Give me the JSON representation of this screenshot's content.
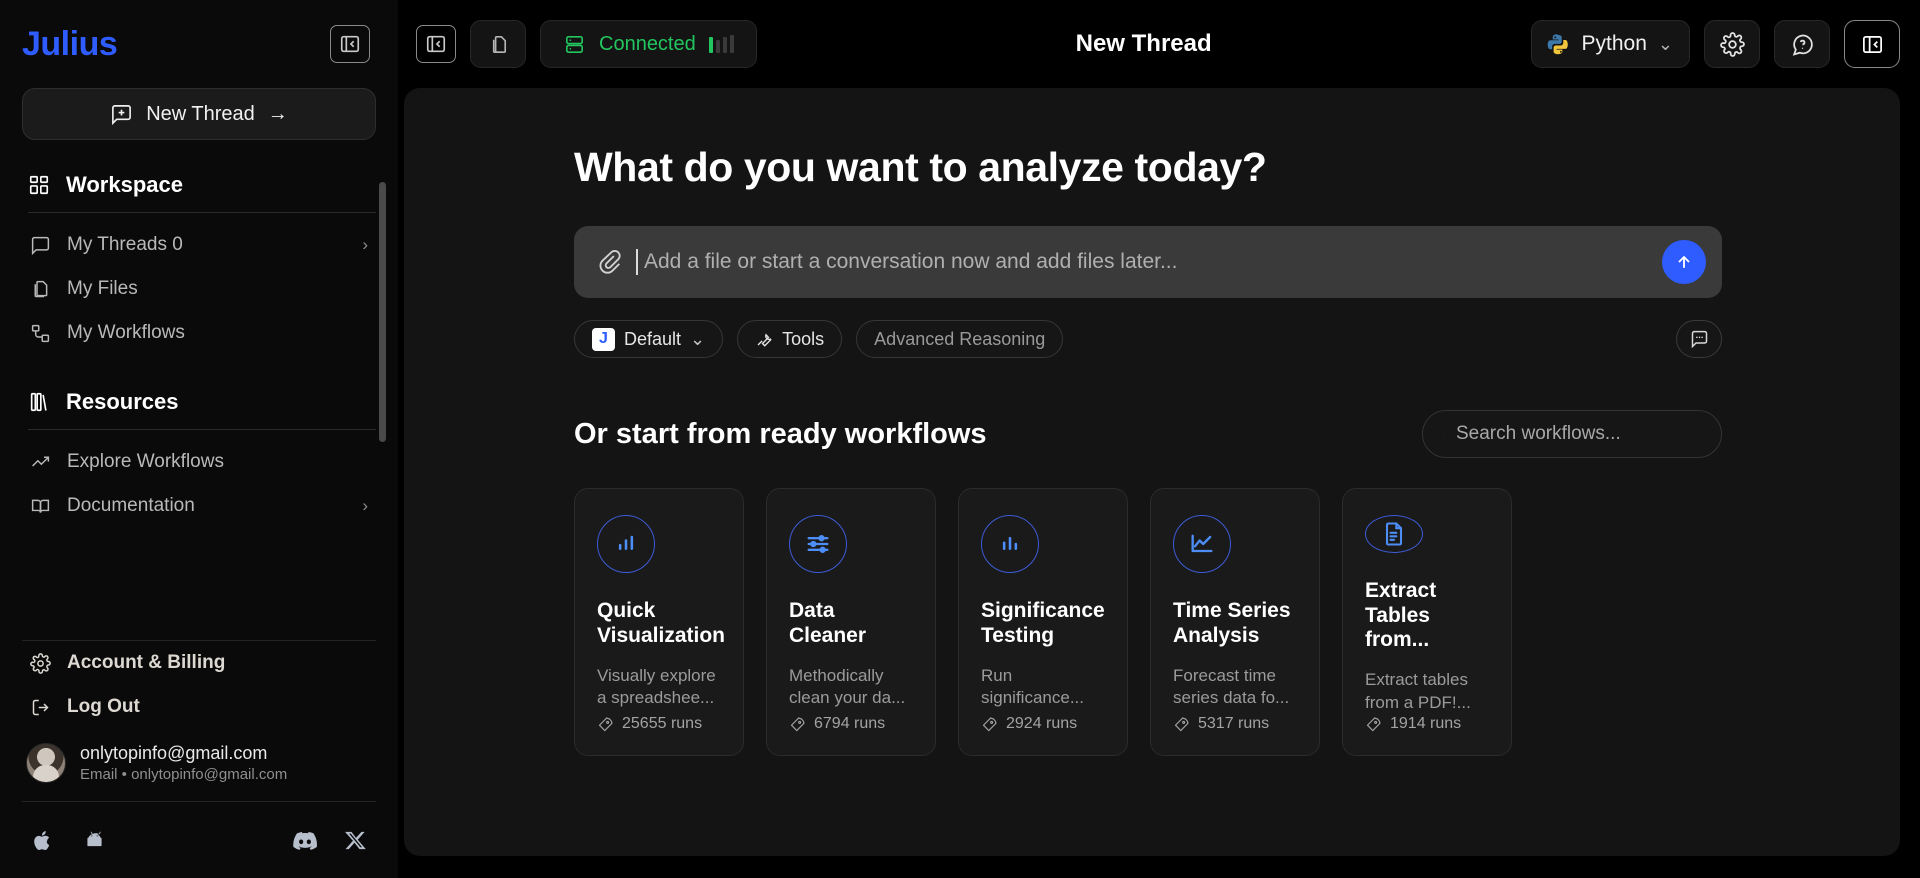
{
  "sidebar": {
    "brand": "Julius",
    "collapse_icon": "panel-collapse-icon",
    "new_thread_label": "New Thread",
    "new_thread_arrow": "→",
    "sections": [
      {
        "label": "Workspace",
        "icon": "grid-icon",
        "items": [
          {
            "label": "My Threads 0",
            "icon": "chat-bubble-icon",
            "chevron": "›"
          },
          {
            "label": "My Files",
            "icon": "files-icon",
            "chevron": ""
          },
          {
            "label": "My Workflows",
            "icon": "workflow-icon",
            "chevron": ""
          }
        ]
      },
      {
        "label": "Resources",
        "icon": "books-icon",
        "items": [
          {
            "label": "Explore Workflows",
            "icon": "trending-up-icon",
            "chevron": ""
          },
          {
            "label": "Documentation",
            "icon": "book-open-icon",
            "chevron": "›"
          }
        ]
      }
    ],
    "footer_items": [
      {
        "label": "Account & Billing",
        "icon": "gear-icon"
      },
      {
        "label": "Log Out",
        "icon": "logout-icon"
      }
    ],
    "profile": {
      "name": "onlytopinfo@gmail.com",
      "subtitle": "Email • onlytopinfo@gmail.com"
    },
    "socials": [
      {
        "name": "apple-icon"
      },
      {
        "name": "android-icon"
      },
      {
        "name": "discord-icon"
      },
      {
        "name": "x-twitter-icon"
      }
    ]
  },
  "topbar": {
    "collapse_icon": "panel-collapse-icon",
    "copy_icon": "duplicate-icon",
    "connection_status": "Connected",
    "connection_color": "#22c55e",
    "title": "New Thread",
    "language": "Python",
    "language_chevron": "⌄",
    "settings_icon": "gear-icon",
    "help_icon": "help-chat-icon",
    "right_panel_icon": "panel-collapse-icon"
  },
  "main": {
    "headline": "What do you want to analyze today?",
    "prompt": {
      "attachment_icon": "paperclip-icon",
      "placeholder": "Add a file or start a conversation now and add files later...",
      "value": "",
      "send_icon": "arrow-up-icon"
    },
    "chips": [
      {
        "label": "Default",
        "badge": "J",
        "chevron": "⌄",
        "muted": false
      },
      {
        "label": "Tools",
        "icon": "wrench-icon",
        "muted": false
      },
      {
        "label": "Advanced Reasoning",
        "muted": true
      }
    ],
    "chat_history_icon": "chat-dots-icon",
    "workflows": {
      "title": "Or start from ready workflows",
      "search_placeholder": "Search workflows...",
      "search_value": "",
      "search_icon": "search-icon",
      "cards": [
        {
          "icon": "bar-chart-icon",
          "title": "Quick Visualization",
          "description": "Visually explore a spreadshee...",
          "runs": "25655 runs"
        },
        {
          "icon": "sliders-icon",
          "title": "Data Cleaner",
          "description": "Methodically clean your da...",
          "runs": "6794 runs"
        },
        {
          "icon": "bar-chart-alt-icon",
          "title": "Significance Testing",
          "description": "Run significance...",
          "runs": "2924 runs"
        },
        {
          "icon": "line-chart-icon",
          "title": "Time Series Analysis",
          "description": "Forecast time series data fo...",
          "runs": "5317 runs"
        },
        {
          "icon": "document-text-icon",
          "title": "Extract Tables from...",
          "description": "Extract tables from a PDF!...",
          "runs": "1914 runs"
        }
      ]
    }
  },
  "colors": {
    "brand": "#2f5cff",
    "accent_blue": "#4d8df6",
    "success_green": "#22c55e",
    "panel": "#141414"
  }
}
